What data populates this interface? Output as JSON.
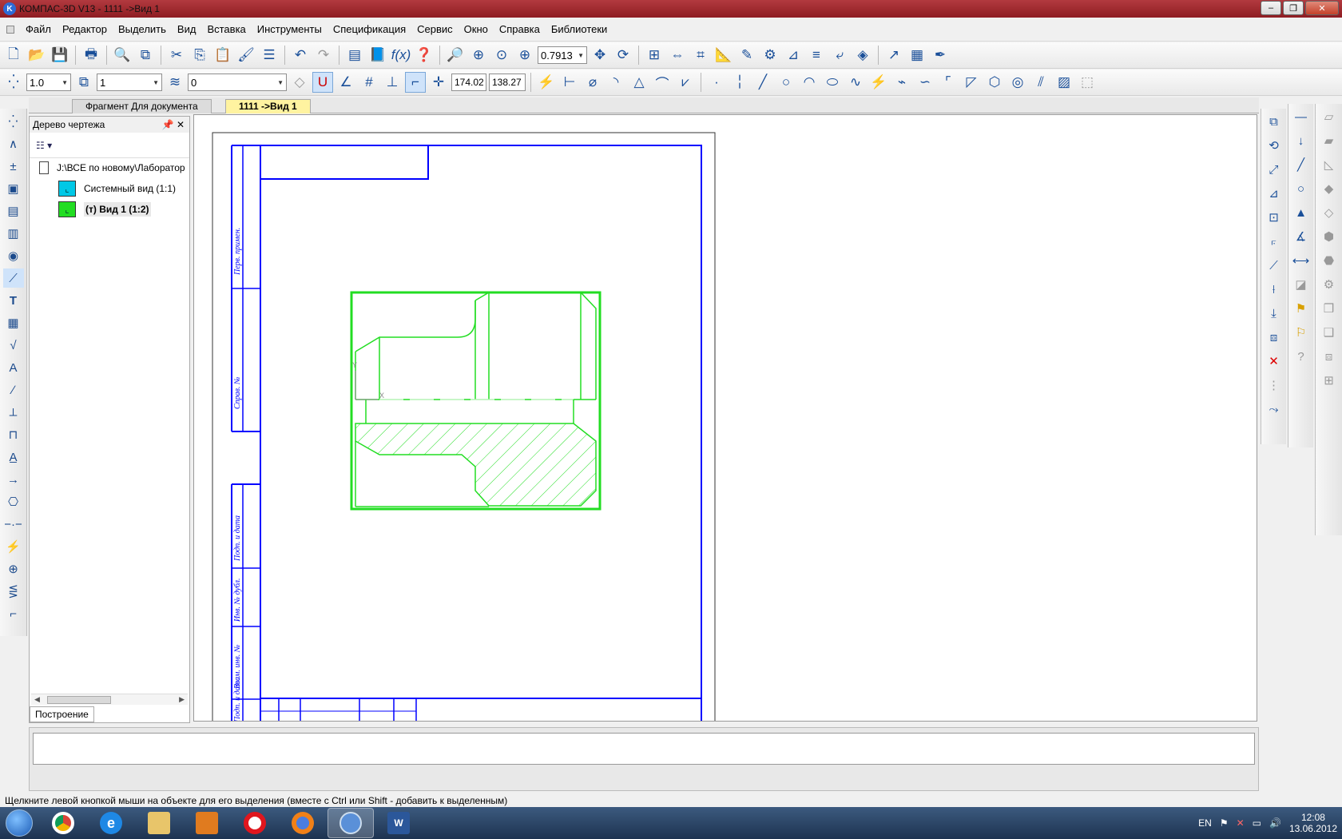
{
  "window": {
    "title": "КОМПАС-3D V13 - 1111 ->Вид 1",
    "app_icon_letter": "K"
  },
  "menu": [
    "Файл",
    "Редактор",
    "Выделить",
    "Вид",
    "Вставка",
    "Инструменты",
    "Спецификация",
    "Сервис",
    "Окно",
    "Справка",
    "Библиотеки"
  ],
  "toolbar1": {
    "zoom_value": "0.7913"
  },
  "toolbar2": {
    "line_style_value": "1.0",
    "view_value": "1",
    "layer_value": "0",
    "coord_x": "174.02",
    "coord_y": "138.27"
  },
  "doc_tabs": {
    "inactive": "Фрагмент Для документа",
    "active": "1111 ->Вид 1"
  },
  "tree": {
    "title": "Дерево чертежа",
    "root_path": "J:\\ВСЕ по новому\\Лаборатор",
    "items": [
      {
        "label": "Системный вид (1:1)",
        "color": "#00c8e6"
      },
      {
        "label": "(т) Вид 1 (1:2)",
        "color": "#22dd22"
      }
    ],
    "bottom_tab": "Построение"
  },
  "frame_labels": {
    "perv_primen": "Перв. примен.",
    "sprav_no": "Справ. №",
    "podp_data_1": "Подп. и дата",
    "inv_dubl": "Инв. № дубл.",
    "vzam_inv": "Взам. инв. №",
    "podp_data_2": "Подп. и дата"
  },
  "axis_labels": {
    "x": "X",
    "y": "Y"
  },
  "status_message": "Щелкните левой кнопкой мыши на объекте для его выделения (вместе с Ctrl или Shift - добавить к выделенным)",
  "tray": {
    "lang": "EN",
    "time": "12:08",
    "date": "13.06.2012"
  },
  "colors": {
    "frame": "#0000ff",
    "view": "#22dd22",
    "title_bar": "#a32b31"
  }
}
